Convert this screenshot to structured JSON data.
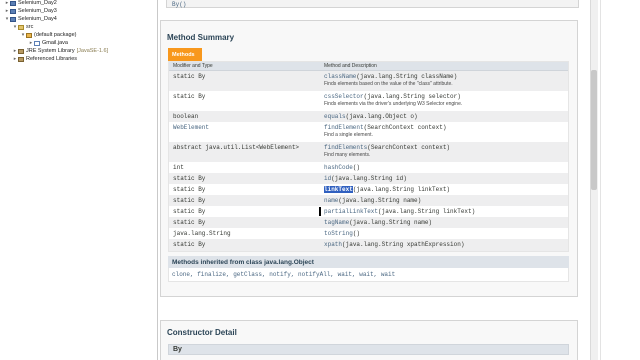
{
  "explorer": {
    "items": [
      {
        "label": "Selenium_Day2",
        "extra": ""
      },
      {
        "label": "Selenium_Day3",
        "extra": ""
      },
      {
        "label": "Selenium_Day4",
        "extra": ""
      },
      {
        "label": "src",
        "extra": ""
      },
      {
        "label": "(default package)",
        "extra": ""
      },
      {
        "label": "Gmail.java",
        "extra": ""
      },
      {
        "label": "JRE System Library",
        "extra": "[JavaSE-1.6]"
      },
      {
        "label": "Referenced Libraries",
        "extra": ""
      }
    ]
  },
  "top_snippet": "By()",
  "method_summary": {
    "heading": "Method Summary",
    "tab_label": "Methods",
    "col_modifier": "Modifier and Type",
    "col_method": "Method and Description",
    "rows": [
      {
        "type": "static By",
        "method": "className",
        "sig": "(java.lang.String className)",
        "desc": "Finds elements based on the value of the \"class\" attribute."
      },
      {
        "type": "static By",
        "method": "cssSelector",
        "sig": "(java.lang.String selector)",
        "desc": "Finds elements via the driver's underlying W3 Selector engine."
      },
      {
        "type": "boolean",
        "method": "equals",
        "sig": "(java.lang.Object o)",
        "desc": ""
      },
      {
        "type": "WebElement",
        "method": "findElement",
        "sig": "(SearchContext context)",
        "desc": "Find a single element."
      },
      {
        "type": "abstract java.util.List<WebElement>",
        "method": "findElements",
        "sig": "(SearchContext context)",
        "desc": "Find many elements."
      },
      {
        "type": "int",
        "method": "hashCode",
        "sig": "()",
        "desc": ""
      },
      {
        "type": "static By",
        "method": "id",
        "sig": "(java.lang.String id)",
        "desc": ""
      },
      {
        "type": "static By",
        "method": "linkText",
        "sig": "(java.lang.String linkText)",
        "desc": ""
      },
      {
        "type": "static By",
        "method": "name",
        "sig": "(java.lang.String name)",
        "desc": ""
      },
      {
        "type": "static By",
        "method": "partialLinkText",
        "sig": "(java.lang.String linkText)",
        "desc": ""
      },
      {
        "type": "static By",
        "method": "tagName",
        "sig": "(java.lang.String name)",
        "desc": ""
      },
      {
        "type": "java.lang.String",
        "method": "toString",
        "sig": "()",
        "desc": ""
      },
      {
        "type": "static By",
        "method": "xpath",
        "sig": "(java.lang.String xpathExpression)",
        "desc": ""
      }
    ]
  },
  "inherited": {
    "heading": "Methods inherited from class java.lang.Object",
    "list": "clone, finalize, getClass, notify, notifyAll, wait, wait, wait"
  },
  "constructor_detail": {
    "heading": "Constructor Detail",
    "name": "By"
  },
  "colors": {
    "tab": "#f8981d",
    "table_header": "#dee3e9",
    "selection": "#3060c0",
    "link": "#4a6782"
  }
}
